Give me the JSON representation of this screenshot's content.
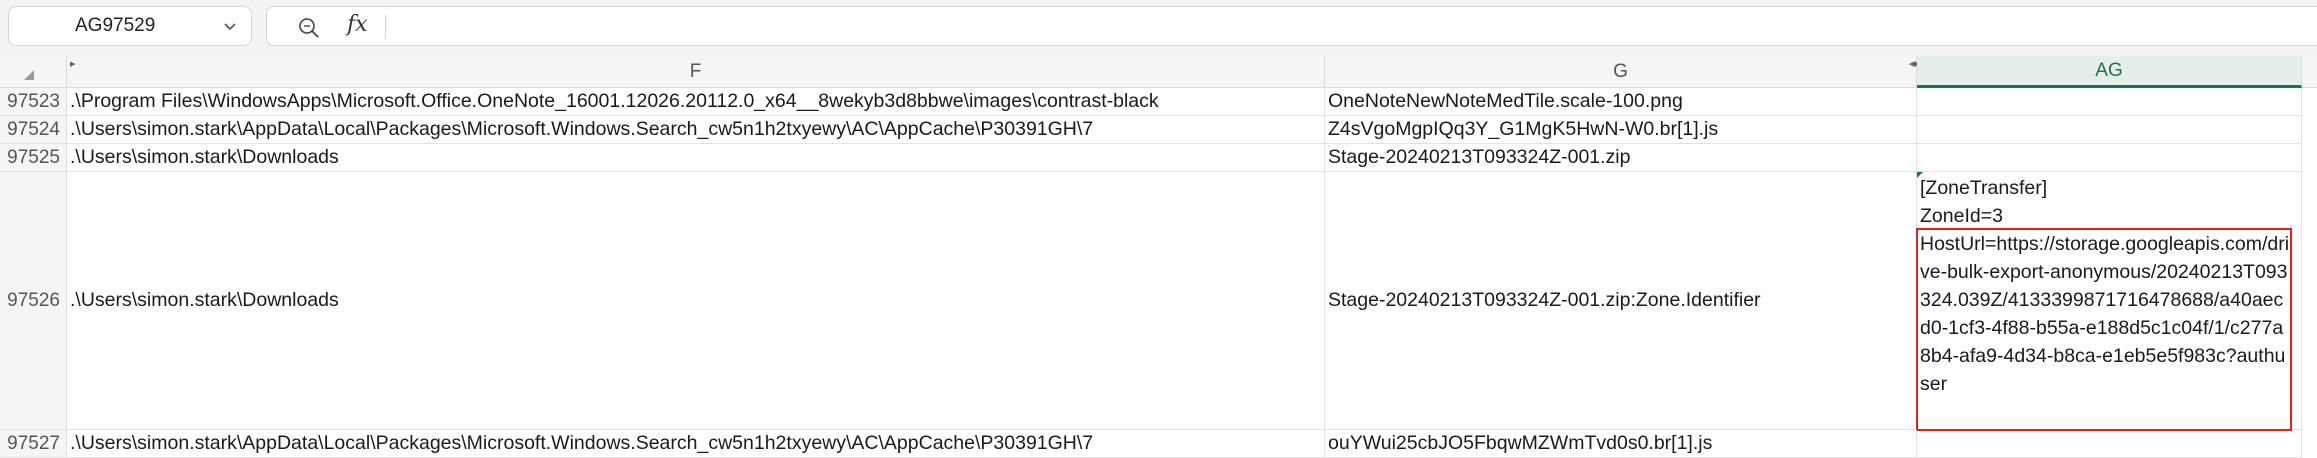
{
  "formula_bar": {
    "name_box": "AG97529",
    "zoom_icon": "zoom-icon",
    "fx_label": "fx",
    "formula": ""
  },
  "columns": [
    {
      "label": "F"
    },
    {
      "label": "G"
    },
    {
      "label": "AG"
    }
  ],
  "rows": [
    {
      "num": "97523",
      "f": ".\\Program Files\\WindowsApps\\Microsoft.Office.OneNote_16001.12026.20112.0_x64__8wekyb3d8bbwe\\images\\contrast-black",
      "g": "OneNoteNewNoteMedTile.scale-100.png",
      "ag": ""
    },
    {
      "num": "97524",
      "f": ".\\Users\\simon.stark\\AppData\\Local\\Packages\\Microsoft.Windows.Search_cw5n1h2txyewy\\AC\\AppCache\\P30391GH\\7",
      "g": "Z4sVgoMgpIQq3Y_G1MgK5HwN-W0.br[1].js",
      "ag": ""
    },
    {
      "num": "97525",
      "f": ".\\Users\\simon.stark\\Downloads",
      "g": "Stage-20240213T093324Z-001.zip",
      "ag": ""
    },
    {
      "num": "97526",
      "f": ".\\Users\\simon.stark\\Downloads",
      "g": "Stage-20240213T093324Z-001.zip:Zone.Identifier",
      "ag_lines": [
        "[ZoneTransfer]",
        "ZoneId=3"
      ],
      "ag_highlight": "HostUrl=https://storage.googleapis.com/drive-bulk-export-anonymous/20240213T093324.039Z/4133399871716478688/a40aecd0-1cf3-4f88-b55a-e188d5c1c04f/1/c277a8b4-afa9-4d34-b8ca-e1eb5e5f983c?authuser"
    },
    {
      "num": "97527",
      "f": ".\\Users\\simon.stark\\AppData\\Local\\Packages\\Microsoft.Windows.Search_cw5n1h2txyewy\\AC\\AppCache\\P30391GH\\7",
      "g": "ouYWui25cbJO5FbqwMZWmTvd0s0.br[1].js",
      "ag": ""
    }
  ],
  "colors": {
    "accent": "#217346",
    "highlight": "#e0201b"
  }
}
